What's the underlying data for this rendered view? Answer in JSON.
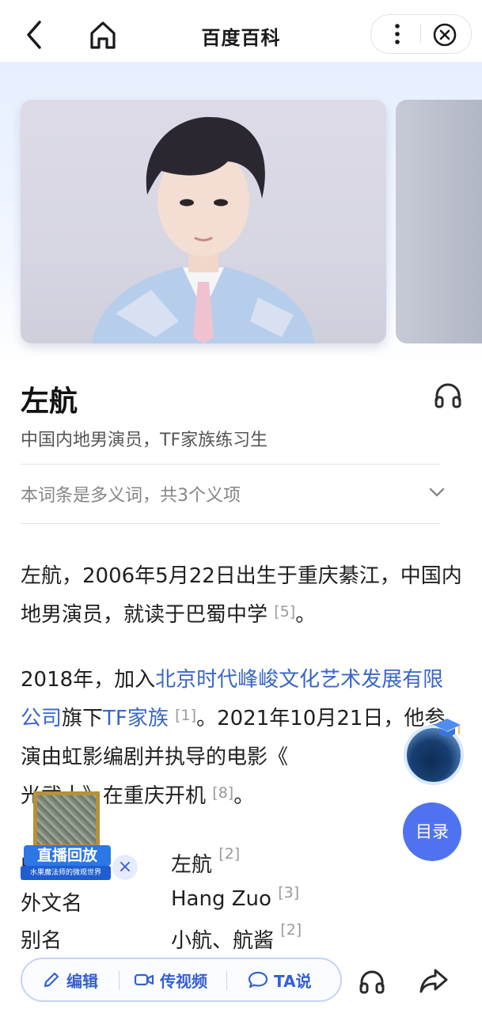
{
  "header": {
    "title": "百度百科",
    "icons": {
      "back": "back-arrow-icon",
      "home": "home-icon",
      "more": "more-vertical-icon",
      "close": "close-circle-icon"
    }
  },
  "entry": {
    "name": "左航",
    "subtitle": "中国内地男演员，TF家族练习生",
    "polysemy": "本词条是多义词，共3个义项"
  },
  "paragraphs": {
    "p1": {
      "text": "左航，2006年5月22日出生于重庆綦江，中国内地男演员，就读于巴蜀中学",
      "ref": "[5]",
      "end": "。"
    },
    "p2": {
      "part1": "2018年，加入",
      "link1": "北京时代峰峻文化艺术发展有限公司",
      "part2": "旗下",
      "link2": "TF家族",
      "ref1": "[1]",
      "part3": "。2021年10月21日，他参演由虹影编剧并执导的电影《",
      "part4": "光武土》在重庆开机",
      "ref2": "[8]",
      "end": "。"
    }
  },
  "infobox": [
    {
      "key": "中文名",
      "value": "左航",
      "ref": "[2]"
    },
    {
      "key": "外文名",
      "value": "Hang Zuo",
      "ref": "[3]"
    },
    {
      "key": "别名",
      "value": "小航、航酱",
      "ref": "[2]"
    }
  ],
  "floating": {
    "toc": "目录",
    "live_label": "直播回放",
    "live_sub": "水果魔法师的微观世界",
    "live_close": "×"
  },
  "bottombar": {
    "edit": "编辑",
    "video": "传视频",
    "ta": "TA说"
  },
  "colors": {
    "accent": "#3460d2",
    "link": "#3866c7",
    "toc_bg": "#4f73f0",
    "live": "#2c76e6"
  }
}
